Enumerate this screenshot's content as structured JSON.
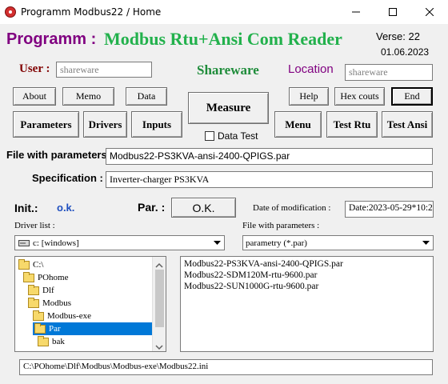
{
  "window": {
    "title": "Programm Modbus22 / Home"
  },
  "header": {
    "programm": "Programm :",
    "app_name": "Modbus Rtu+Ansi Com Reader",
    "verse": "Verse: 22",
    "date": "01.06.2023",
    "user_label": "User :",
    "user_value": "shareware",
    "license": "Shareware",
    "location_label": "Location",
    "location_value": "shareware"
  },
  "buttons": {
    "about": "About",
    "memo": "Memo",
    "data": "Data",
    "measure": "Measure",
    "help": "Help",
    "hex_couts": "Hex couts",
    "end": "End",
    "parameters": "Parameters",
    "drivers": "Drivers",
    "inputs": "Inputs",
    "menu": "Menu",
    "test_rtu": "Test Rtu",
    "test_ansi": "Test Ansi",
    "ok": "O.K."
  },
  "data_test_label": "Data Test",
  "file_params": {
    "label": "File with parameters :",
    "value": "Modbus22-PS3KVA-ansi-2400-QPIGS.par"
  },
  "specification": {
    "label": "Specification :",
    "value": "Inverter-charger PS3KVA"
  },
  "status": {
    "init_label": "Init.:",
    "init_value": "o.k.",
    "par_label": "Par. :",
    "date_mod_label": "Date of  modification :",
    "date_mod_value": "Date:2023-05-29*10:2"
  },
  "driver_list": {
    "label": "Driver list :",
    "value": "c: [windows]"
  },
  "file_filter": {
    "label": "File with parameters :",
    "value": "parametry (*.par)"
  },
  "tree": {
    "items": [
      {
        "label": "C:\\",
        "indent": 0
      },
      {
        "label": "POhome",
        "indent": 1
      },
      {
        "label": "Dlf",
        "indent": 2
      },
      {
        "label": "Modbus",
        "indent": 3
      },
      {
        "label": "Modbus-exe",
        "indent": 4
      },
      {
        "label": "Par",
        "indent": 5,
        "selected": true
      },
      {
        "label": "bak",
        "indent": 6
      }
    ]
  },
  "files": [
    "Modbus22-PS3KVA-ansi-2400-QPIGS.par",
    "Modbus22-SDM120M-rtu-9600.par",
    "Modbus22-SUN1000G-rtu-9600.par"
  ],
  "path": "C:\\POhome\\Dlf\\Modbus\\Modbus-exe\\Modbus22.ini",
  "colors": {
    "programm": "#800080",
    "app_name": "#22b14c",
    "user_label": "#800000",
    "shareware": "#1e8c3a",
    "location": "#800080",
    "init_value": "#1f4fbf",
    "selection": "#0078d7"
  }
}
